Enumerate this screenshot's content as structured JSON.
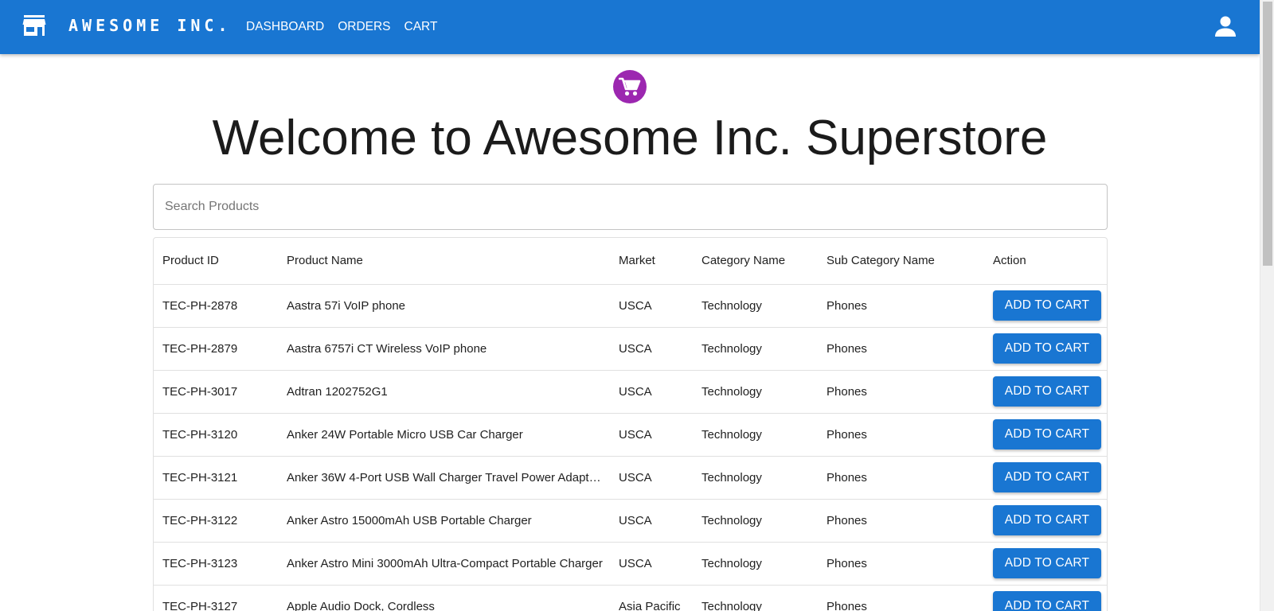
{
  "appbar": {
    "brand": "AWESOME INC.",
    "nav": [
      "DASHBOARD",
      "ORDERS",
      "CART"
    ],
    "icons": {
      "store": "store-icon",
      "account": "account-icon"
    },
    "color": "#1976d2"
  },
  "hero": {
    "icon": "shopping-cart-icon",
    "icon_color": "#9c27b0",
    "title": "Welcome to Awesome Inc. Superstore"
  },
  "search": {
    "placeholder": "Search Products",
    "value": ""
  },
  "table": {
    "headers": [
      "Product ID",
      "Product Name",
      "Market",
      "Category Name",
      "Sub Category Name",
      "Action"
    ],
    "action_label": "ADD TO CART",
    "rows": [
      [
        "TEC-PH-2878",
        "Aastra 57i VoIP phone",
        "USCA",
        "Technology",
        "Phones"
      ],
      [
        "TEC-PH-2879",
        "Aastra 6757i CT Wireless VoIP phone",
        "USCA",
        "Technology",
        "Phones"
      ],
      [
        "TEC-PH-3017",
        "Adtran 1202752G1",
        "USCA",
        "Technology",
        "Phones"
      ],
      [
        "TEC-PH-3120",
        "Anker 24W Portable Micro USB Car Charger",
        "USCA",
        "Technology",
        "Phones"
      ],
      [
        "TEC-PH-3121",
        "Anker 36W 4-Port USB Wall Charger Travel Power Adapt…",
        "USCA",
        "Technology",
        "Phones"
      ],
      [
        "TEC-PH-3122",
        "Anker Astro 15000mAh USB Portable Charger",
        "USCA",
        "Technology",
        "Phones"
      ],
      [
        "TEC-PH-3123",
        "Anker Astro Mini 3000mAh Ultra-Compact Portable Charger",
        "USCA",
        "Technology",
        "Phones"
      ],
      [
        "TEC-PH-3127",
        "Apple Audio Dock, Cordless",
        "Asia Pacific",
        "Technology",
        "Phones"
      ]
    ]
  }
}
